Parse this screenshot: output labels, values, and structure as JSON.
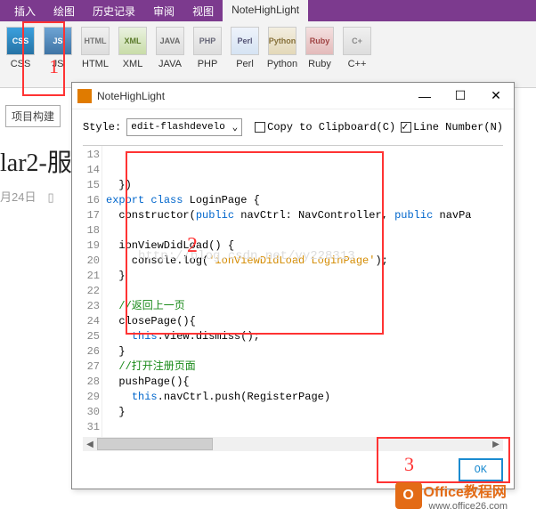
{
  "ribbon": {
    "tabs": [
      "插入",
      "绘图",
      "历史记录",
      "审阅",
      "视图",
      "NoteHighLight"
    ],
    "active": 5,
    "buttons": [
      {
        "icon": "CSS",
        "label": "CSS"
      },
      {
        "icon": "JS",
        "label": "JS"
      },
      {
        "icon": "HTML",
        "label": "HTML"
      },
      {
        "icon": "XML",
        "label": "XML"
      },
      {
        "icon": "JAVA",
        "label": "JAVA"
      },
      {
        "icon": "PHP",
        "label": "PHP"
      },
      {
        "icon": "Perl",
        "label": "Perl"
      },
      {
        "icon": "Python",
        "label": "Python"
      },
      {
        "icon": "Ruby",
        "label": "Ruby"
      },
      {
        "icon": "C+",
        "label": "C++"
      }
    ]
  },
  "background": {
    "project_tab": "项目构建",
    "title_fragment": "lar2-服",
    "date_fragment": "月24日"
  },
  "dialog": {
    "title": "NoteHighLight",
    "style_label": "Style:",
    "style_value": "edit-flashdevelo",
    "copy_label": "Copy to Clipboard(C)",
    "line_label": "Line Number(N)",
    "copy_checked": false,
    "line_checked": true,
    "ok_label": "OK",
    "watermark": "http://blog.csdn.net/yy228313",
    "gutter": [
      "13",
      "14",
      "15",
      "16",
      "17",
      "18",
      "19",
      "20",
      "21",
      "22",
      "23",
      "24",
      "25",
      "26",
      "27",
      "28",
      "29",
      "30",
      "31"
    ],
    "code": {
      "l13": "  })",
      "l14a": "export",
      "l14b": " class",
      "l14c": " LoginPage {",
      "l15a": "  constructor(",
      "l15b": "public",
      "l15c": " navCtrl: NavController, ",
      "l15d": "public",
      "l15e": " navPa",
      "l16": "",
      "l17": "  ionViewDidLoad() {",
      "l18a": "    console.log(",
      "l18b": "'ionViewDidLoad LoginPage'",
      "l18c": ");",
      "l19": "  }",
      "l20": "",
      "l21a": "  ",
      "l21b": "//返回上一页",
      "l22": "  closePage(){",
      "l23a": "    ",
      "l23b": "this",
      "l23c": ".view.dismiss();",
      "l24": "  }",
      "l25a": "  ",
      "l25b": "//打开注册页面",
      "l26": "  pushPage(){",
      "l27a": "    ",
      "l27b": "this",
      "l27c": ".navCtrl.push(RegisterPage)",
      "l28": "  }",
      "l29": "",
      "l30": "}",
      "l31": ""
    }
  },
  "annotations": {
    "n1": "1",
    "n2": "2",
    "n3": "3"
  },
  "logo": {
    "badge": "O",
    "main": "Office教程网",
    "sub": "www.office26.com"
  }
}
